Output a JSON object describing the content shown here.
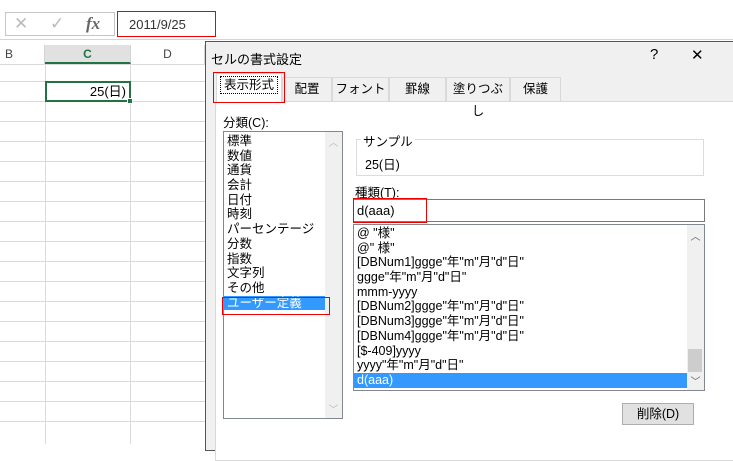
{
  "formula_bar": {
    "cancel_icon": "✕",
    "enter_icon": "✓",
    "fx_label": "fx",
    "value": "2011/9/25"
  },
  "sheet": {
    "columns": [
      "B",
      "C",
      "D"
    ],
    "active_cell_value": "25(日)"
  },
  "dialog": {
    "title": "セルの書式設定",
    "help": "?",
    "close": "✕",
    "tabs": [
      "表示形式",
      "配置",
      "フォント",
      "罫線",
      "塗りつぶし",
      "保護"
    ],
    "category_label": "分類(C):",
    "categories": [
      "標準",
      "数値",
      "通貨",
      "会計",
      "日付",
      "時刻",
      "パーセンテージ",
      "分数",
      "指数",
      "文字列",
      "その他",
      "ユーザー定義"
    ],
    "selected_category": "ユーザー定義",
    "sample_label": "サンプル",
    "sample_value": "25(日)",
    "type_label": "種類(T):",
    "type_value": "d(aaa)",
    "type_list": [
      "@ \"様\"",
      "@\" 様\"",
      "[DBNum1]ggge\"年\"m\"月\"d\"日\"",
      "ggge\"年\"m\"月\"d\"日\"",
      "mmm-yyyy",
      "[DBNum2]ggge\"年\"m\"月\"d\"日\"",
      "[DBNum3]ggge\"年\"m\"月\"d\"日\"",
      "[DBNum4]ggge\"年\"m\"月\"d\"日\"",
      "[$-409]yyyy",
      "yyyy\"年\"m\"月\"d\"日\"",
      "d(aaa)"
    ],
    "selected_type": "d(aaa)",
    "delete_button": "削除(D)"
  }
}
